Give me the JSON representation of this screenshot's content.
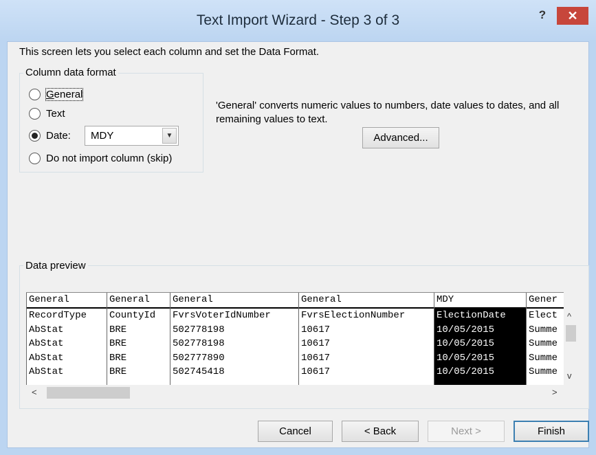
{
  "window": {
    "title": "Text Import Wizard - Step 3 of 3",
    "help_label": "?",
    "close_label": "✕"
  },
  "instructions": "This screen lets you select each column and set the Data Format.",
  "column_format": {
    "group_label": "Column data format",
    "options": [
      {
        "label": "General",
        "selected": false
      },
      {
        "label": "Text",
        "selected": false
      },
      {
        "label": "Date:",
        "selected": true
      },
      {
        "label": "Do not import column (skip)",
        "selected": false
      }
    ],
    "date_value": "MDY"
  },
  "description": "'General' converts numeric values to numbers, date values to dates, and all remaining values to text.",
  "advanced_label": "Advanced...",
  "data_preview": {
    "label": "Data preview",
    "columns": [
      {
        "format": "General",
        "cells": [
          "RecordType",
          "AbStat",
          "AbStat",
          "AbStat",
          "AbStat"
        ]
      },
      {
        "format": "General",
        "cells": [
          "CountyId",
          "BRE",
          "BRE",
          "BRE",
          "BRE"
        ]
      },
      {
        "format": "General",
        "cells": [
          "FvrsVoterIdNumber",
          "502778198",
          "502778198",
          "502777890",
          "502745418"
        ]
      },
      {
        "format": "General",
        "cells": [
          "FvrsElectionNumber",
          "10617",
          "10617",
          "10617",
          "10617"
        ]
      },
      {
        "format": "MDY",
        "cells": [
          "ElectionDate",
          "10/05/2015",
          "10/05/2015",
          "10/05/2015",
          "10/05/2015"
        ]
      },
      {
        "format": "Gener",
        "cells": [
          "Elect",
          "Summe",
          "Summe",
          "Summe",
          "Summe"
        ]
      }
    ],
    "selected_column": 4
  },
  "buttons": {
    "cancel": "Cancel",
    "back": "< Back",
    "next": "Next >",
    "finish": "Finish"
  }
}
